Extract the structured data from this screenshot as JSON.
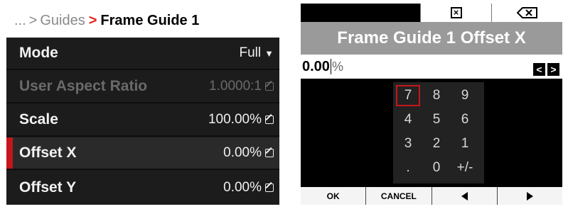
{
  "left_menu": {
    "breadcrumb": {
      "prefix": "...",
      "sep1": ">",
      "parent": "Guides",
      "sep2": ">",
      "current": "Frame Guide 1"
    },
    "rows": [
      {
        "label": "Mode",
        "value": "Full",
        "control": "dropdown"
      },
      {
        "label": "User Aspect Ratio",
        "value": "1.0000:1",
        "control": "edit",
        "disabled": true
      },
      {
        "label": "Scale",
        "value": "100.00%",
        "control": "edit"
      },
      {
        "label": "Offset X",
        "value": "0.00%",
        "control": "edit",
        "selected": true
      },
      {
        "label": "Offset Y",
        "value": "0.00%",
        "control": "edit"
      }
    ]
  },
  "keypad_screen": {
    "title": "Frame Guide 1 Offset X",
    "entry_value": "0.00",
    "entry_unit": "%",
    "left_arrow": "<",
    "right_arrow": ">",
    "keys": [
      "7",
      "8",
      "9",
      "4",
      "5",
      "6",
      "3",
      "2",
      "1",
      ".",
      "0",
      "+/-"
    ],
    "selected_key": "7",
    "softkeys": {
      "ok": "OK",
      "cancel": "CANCEL"
    },
    "icons": [
      "clear-x-icon",
      "backspace-icon",
      "left-triangle-icon",
      "right-triangle-icon"
    ]
  },
  "colors": {
    "accent": "#c4161c",
    "title_bar": "#9a9a9a",
    "menu_bg": "#1c1c1c"
  }
}
